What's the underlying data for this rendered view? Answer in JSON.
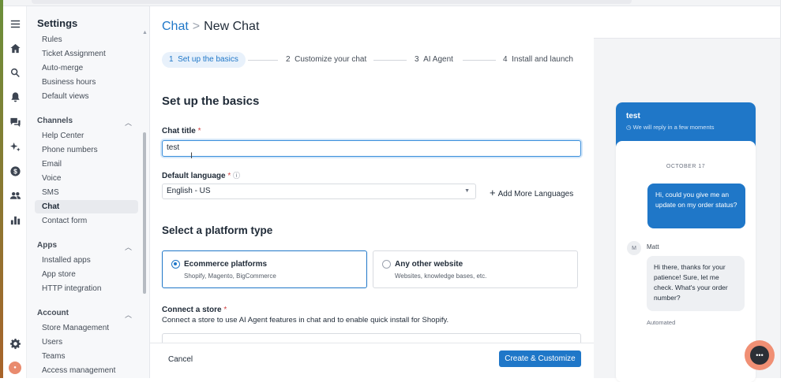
{
  "colors": {
    "accent": "#1f77c8",
    "launcher": "#f08f74"
  },
  "rail": {
    "icons": [
      "menu-icon",
      "home-icon",
      "search-icon",
      "bell-icon",
      "chat-bubbles-icon",
      "sparkle-icon",
      "dollar-icon",
      "users-icon",
      "bar-chart-icon",
      "gear-icon",
      "avatar"
    ]
  },
  "sidebar": {
    "title": "Settings",
    "items_top": [
      "Rules",
      "Ticket Assignment",
      "Auto-merge",
      "Business hours",
      "Default views"
    ],
    "channels": {
      "label": "Channels",
      "items": [
        "Help Center",
        "Phone numbers",
        "Email",
        "Voice",
        "SMS",
        "Chat",
        "Contact form"
      ]
    },
    "apps": {
      "label": "Apps",
      "items": [
        "Installed apps",
        "App store",
        "HTTP integration"
      ]
    },
    "account": {
      "label": "Account",
      "items": [
        "Store Management",
        "Users",
        "Teams",
        "Access management"
      ]
    }
  },
  "breadcrumb": {
    "parent": "Chat",
    "sep": ">",
    "current": "New Chat"
  },
  "steps": [
    {
      "num": "1",
      "label": "Set up the basics"
    },
    {
      "num": "2",
      "label": "Customize your chat"
    },
    {
      "num": "3",
      "label": "AI Agent"
    },
    {
      "num": "4",
      "label": "Install and launch"
    }
  ],
  "form": {
    "heading": "Set up the basics",
    "chat_title_label": "Chat title",
    "req": "*",
    "chat_title_value": "test",
    "language_label": "Default language",
    "language_value": "English - US",
    "add_languages": "Add More Languages",
    "platform_heading": "Select a platform type",
    "platforms": [
      {
        "title": "Ecommerce platforms",
        "sub": "Shopify, Magento, BigCommerce",
        "selected": true
      },
      {
        "title": "Any other website",
        "sub": "Websites, knowledge bases, etc.",
        "selected": false
      }
    ],
    "store_label": "Connect a store",
    "store_desc": "Connect a store to use AI Agent features in chat and to enable quick install for Shopify."
  },
  "footer": {
    "cancel": "Cancel",
    "create": "Create & Customize"
  },
  "preview": {
    "name": "test",
    "reply": "We will reply in a few moments",
    "date": "OCTOBER 17",
    "user_msg": "Hi, could you give me an update on my order status?",
    "avatar": "M",
    "agent": "Matt",
    "agent_msg": "Hi there, thanks for your patience! Sure, let me check. What's your order number?",
    "automated": "Automated"
  }
}
